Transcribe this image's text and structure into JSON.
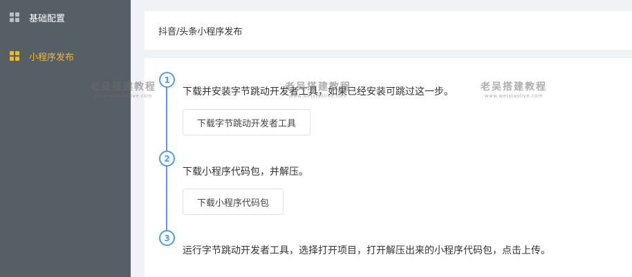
{
  "sidebar": {
    "items": [
      {
        "label": "基础配置",
        "icon": "grid-icon",
        "active": false
      },
      {
        "label": "小程序发布",
        "icon": "grid-icon",
        "active": true
      }
    ]
  },
  "breadcrumb": {
    "text": "抖音/头条小程序发布"
  },
  "steps": [
    {
      "number": "1",
      "text": "下载并安装字节跳动开发者工具，如果已经安装可跳过这一步。",
      "button_label": "下载字节跳动开发者工具"
    },
    {
      "number": "2",
      "text": "下载小程序代码包，并解压。",
      "button_label": "下载小程序代码包"
    },
    {
      "number": "3",
      "text": "运行字节跳动开发者工具，选择打开项目，打开解压出来的小程序代码包，点击上传。"
    }
  ],
  "watermark": {
    "title": "老吴搭建教程",
    "url": "www.weixiaolive.com"
  },
  "colors": {
    "sidebar_bg": "#575f66",
    "active": "#f5b721",
    "timeline": "#4a9ff5"
  }
}
